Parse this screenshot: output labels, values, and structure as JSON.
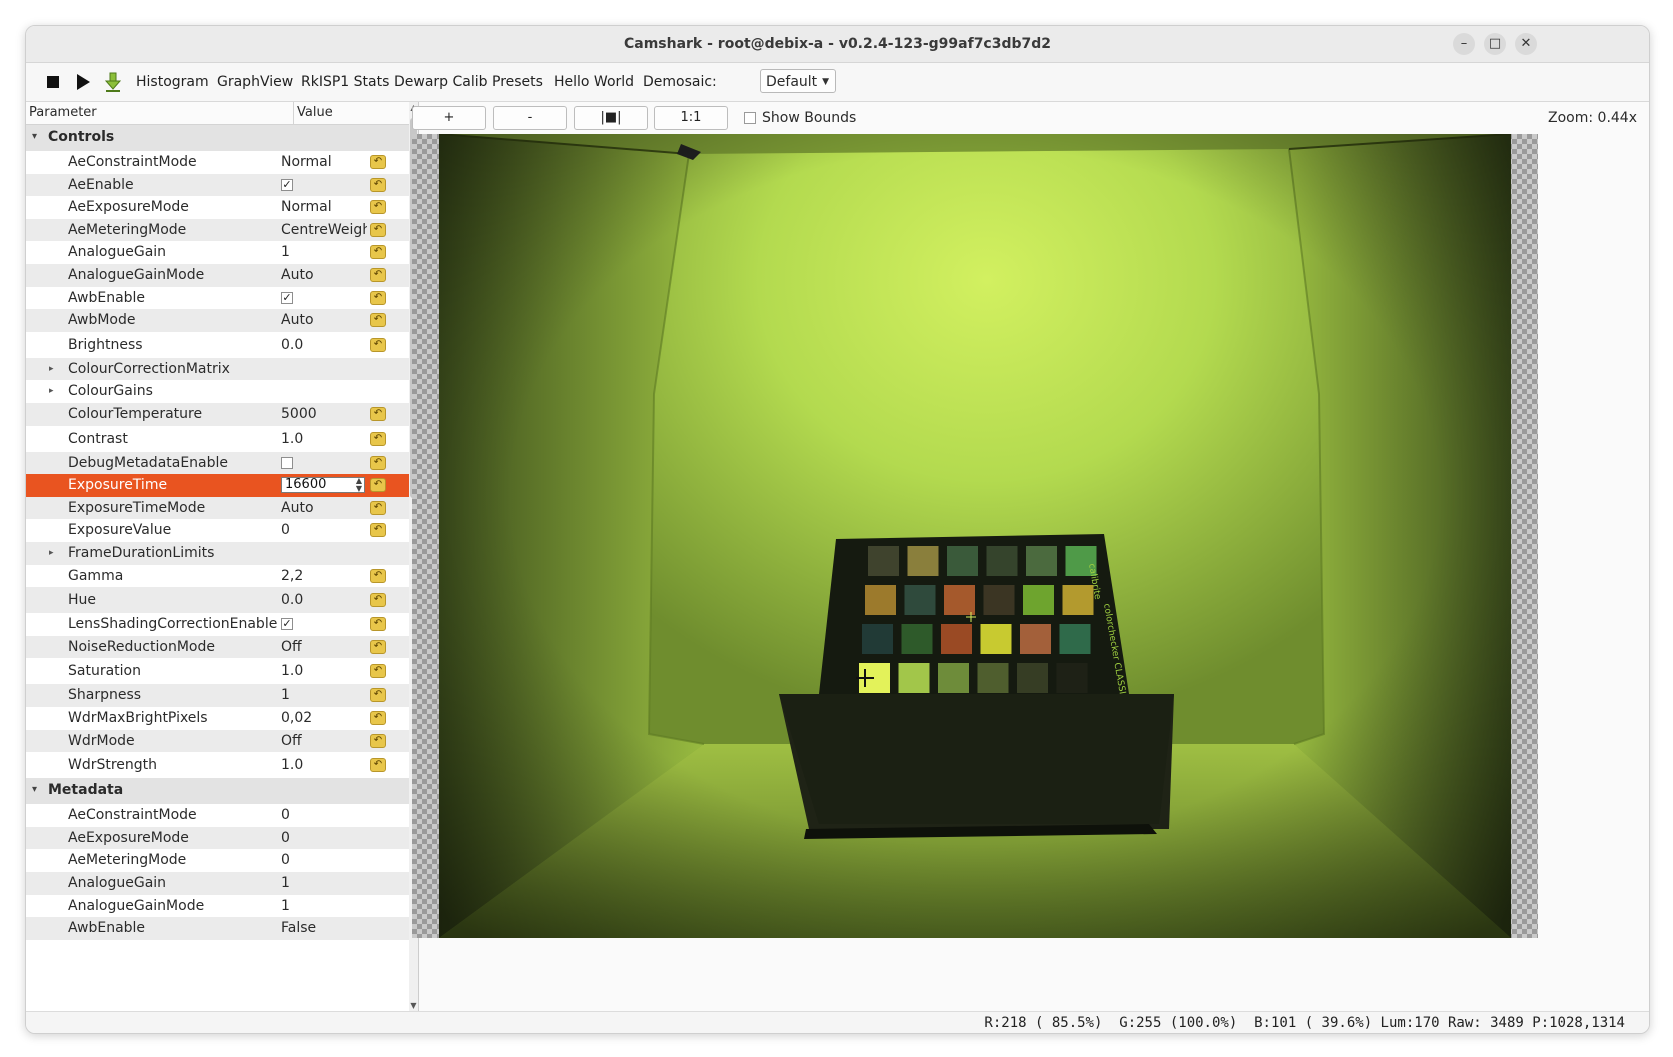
{
  "window": {
    "title": "Camshark - root@debix-a - v0.2.4-123-g99af7c3db7d2",
    "minimize_glyph": "–",
    "maximize_glyph": "□",
    "close_glyph": "✕"
  },
  "toolbar": {
    "items": [
      "Histogram",
      "GraphView",
      "RkISP1 Stats",
      "Dewarp Calib",
      "Presets",
      "Hello World"
    ],
    "demosaic_label": "Demosaic:",
    "demosaic_value": "Default",
    "icons": [
      "stop-icon",
      "play-icon",
      "download-icon"
    ]
  },
  "params": {
    "header": {
      "parameter": "Parameter",
      "value": "Value"
    },
    "sections": [
      {
        "title": "Controls",
        "rows": [
          {
            "name": "AeConstraintMode",
            "value": "Normal",
            "reset": true
          },
          {
            "name": "AeEnable",
            "check": true,
            "reset": true
          },
          {
            "name": "AeExposureMode",
            "value": "Normal",
            "reset": true
          },
          {
            "name": "AeMeteringMode",
            "value": "CentreWeighted",
            "reset": true
          },
          {
            "name": "AnalogueGain",
            "value": "1",
            "reset": true
          },
          {
            "name": "AnalogueGainMode",
            "value": "Auto",
            "reset": true
          },
          {
            "name": "AwbEnable",
            "check": true,
            "reset": true
          },
          {
            "name": "AwbMode",
            "value": "Auto",
            "reset": true
          },
          {
            "name": "Brightness",
            "value": "0.0",
            "reset": true,
            "tall": true
          },
          {
            "name": "ColourCorrectionMatrix",
            "expandable": true
          },
          {
            "name": "ColourGains",
            "expandable": true
          },
          {
            "name": "ColourTemperature",
            "value": "5000",
            "reset": true
          },
          {
            "name": "Contrast",
            "value": "1.0",
            "reset": true,
            "tall": true
          },
          {
            "name": "DebugMetadataEnable",
            "check": false,
            "reset": true
          },
          {
            "name": "ExposureTime",
            "value": "16600",
            "reset": true,
            "selected": true,
            "spin": true
          },
          {
            "name": "ExposureTimeMode",
            "value": "Auto",
            "reset": true
          },
          {
            "name": "ExposureValue",
            "value": "0",
            "reset": true
          },
          {
            "name": "FrameDurationLimits",
            "expandable": true
          },
          {
            "name": "Gamma",
            "value": "2,2",
            "reset": true
          },
          {
            "name": "Hue",
            "value": "0.0",
            "reset": true,
            "tall": true
          },
          {
            "name": "LensShadingCorrectionEnable",
            "check": true,
            "reset": true
          },
          {
            "name": "NoiseReductionMode",
            "value": "Off",
            "reset": true
          },
          {
            "name": "Saturation",
            "value": "1.0",
            "reset": true,
            "tall": true
          },
          {
            "name": "Sharpness",
            "value": "1",
            "reset": true
          },
          {
            "name": "WdrMaxBrightPixels",
            "value": "0,02",
            "reset": true
          },
          {
            "name": "WdrMode",
            "value": "Off",
            "reset": true
          },
          {
            "name": "WdrStrength",
            "value": "1.0",
            "reset": true,
            "tall": true
          }
        ]
      },
      {
        "title": "Metadata",
        "rows": [
          {
            "name": "AeConstraintMode",
            "value": "0"
          },
          {
            "name": "AeExposureMode",
            "value": "0"
          },
          {
            "name": "AeMeteringMode",
            "value": "0"
          },
          {
            "name": "AnalogueGain",
            "value": "1"
          },
          {
            "name": "AnalogueGainMode",
            "value": "1"
          },
          {
            "name": "AwbEnable",
            "value": "False"
          }
        ]
      }
    ]
  },
  "viewer": {
    "zoom_in": "+",
    "zoom_out": "-",
    "fit": "|■|",
    "one_to_one": "1:1",
    "show_bounds": "Show Bounds",
    "zoom_label": "Zoom: 0.44x"
  },
  "colors": {
    "accent": "#e95420",
    "image_green": "#b8df50",
    "chart_patches": [
      [
        "#3f432d",
        "#8a7f3c",
        "#3a5a3a",
        "#35442c",
        "#4b6a3e",
        "#4f9a48"
      ],
      [
        "#9c7a2c",
        "#2f4a3c",
        "#a5592c",
        "#3b3523",
        "#6ea42e",
        "#b39a2e"
      ],
      [
        "#213a36",
        "#2e5a2a",
        "#9a4a24",
        "#c8ca30",
        "#a3603a",
        "#2f6a4a"
      ],
      [
        "#e3f25a",
        "#a2c64a",
        "#6e8c3a",
        "#4f5e2e",
        "#363d24",
        "#1e2116"
      ]
    ]
  },
  "status": {
    "readout": "R:218 ( 85.5%)  G:255 (100.0%)  B:101 ( 39.6%) Lum:170 Raw: 3489 P:1028,1314"
  }
}
